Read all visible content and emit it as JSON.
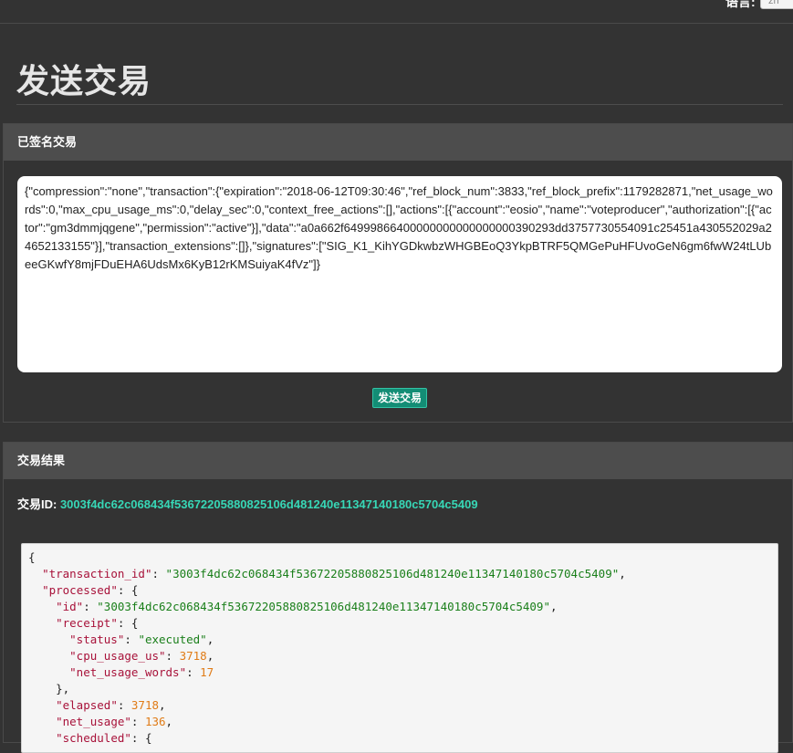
{
  "topbar": {
    "language_label": "语言:",
    "language_value": "zh"
  },
  "page": {
    "title": "发送交易"
  },
  "signed_panel": {
    "heading": "已签名交易",
    "signed_transaction": "{\"compression\":\"none\",\"transaction\":{\"expiration\":\"2018-06-12T09:30:46\",\"ref_block_num\":3833,\"ref_block_prefix\":1179282871,\"net_usage_words\":0,\"max_cpu_usage_ms\":0,\"delay_sec\":0,\"context_free_actions\":[],\"actions\":[{\"account\":\"eosio\",\"name\":\"voteproducer\",\"authorization\":[{\"actor\":\"gm3dmmjqgene\",\"permission\":\"active\"}],\"data\":\"a0a662f64999866400000000000000000390293dd3757730554091c25451a430552029a24652133155\"}],\"transaction_extensions\":[]},\"signatures\":[\"SIG_K1_KihYGDkwbzWHGBEoQ3YkpBTRF5QMGePuHFUvoGeN6gm6fwW24tLUbeeGKwfY8mjFDuEHA6UdsMx6KyB12rKMSuiyaK4fVz\"]}",
    "send_button_label": "发送交易"
  },
  "result_panel": {
    "heading": "交易结果",
    "txid_label": "交易ID: ",
    "txid_value": "3003f4dc62c068434f53672205880825106d481240e11347140180c5704c5409",
    "json_lines": [
      {
        "indent": "",
        "parts": [
          [
            "p",
            "{"
          ]
        ]
      },
      {
        "indent": "  ",
        "parts": [
          [
            "k",
            "\"transaction_id\""
          ],
          [
            "p",
            ": "
          ],
          [
            "s",
            "\"3003f4dc62c068434f53672205880825106d481240e11347140180c5704c5409\""
          ],
          [
            "p",
            ","
          ]
        ]
      },
      {
        "indent": "  ",
        "parts": [
          [
            "k",
            "\"processed\""
          ],
          [
            "p",
            ": {"
          ]
        ]
      },
      {
        "indent": "    ",
        "parts": [
          [
            "k",
            "\"id\""
          ],
          [
            "p",
            ": "
          ],
          [
            "s",
            "\"3003f4dc62c068434f53672205880825106d481240e11347140180c5704c5409\""
          ],
          [
            "p",
            ","
          ]
        ]
      },
      {
        "indent": "    ",
        "parts": [
          [
            "k",
            "\"receipt\""
          ],
          [
            "p",
            ": {"
          ]
        ]
      },
      {
        "indent": "      ",
        "parts": [
          [
            "k",
            "\"status\""
          ],
          [
            "p",
            ": "
          ],
          [
            "s",
            "\"executed\""
          ],
          [
            "p",
            ","
          ]
        ]
      },
      {
        "indent": "      ",
        "parts": [
          [
            "k",
            "\"cpu_usage_us\""
          ],
          [
            "p",
            ": "
          ],
          [
            "n",
            "3718"
          ],
          [
            "p",
            ","
          ]
        ]
      },
      {
        "indent": "      ",
        "parts": [
          [
            "k",
            "\"net_usage_words\""
          ],
          [
            "p",
            ": "
          ],
          [
            "n",
            "17"
          ]
        ]
      },
      {
        "indent": "    ",
        "parts": [
          [
            "p",
            "},"
          ]
        ]
      },
      {
        "indent": "    ",
        "parts": [
          [
            "k",
            "\"elapsed\""
          ],
          [
            "p",
            ": "
          ],
          [
            "n",
            "3718"
          ],
          [
            "p",
            ","
          ]
        ]
      },
      {
        "indent": "    ",
        "parts": [
          [
            "k",
            "\"net_usage\""
          ],
          [
            "p",
            ": "
          ],
          [
            "n",
            "136"
          ],
          [
            "p",
            ","
          ]
        ]
      },
      {
        "indent": "    ",
        "parts": [
          [
            "k",
            "\"scheduled\""
          ],
          [
            "p",
            ": {"
          ]
        ]
      }
    ]
  },
  "colors": {
    "background": "#333333",
    "panel_header": "#4d4d4d",
    "accent": "#37d7b6",
    "button": "#138d75",
    "json_key": "#a8123a",
    "json_string": "#1a7f1a",
    "json_number": "#e07b16"
  }
}
